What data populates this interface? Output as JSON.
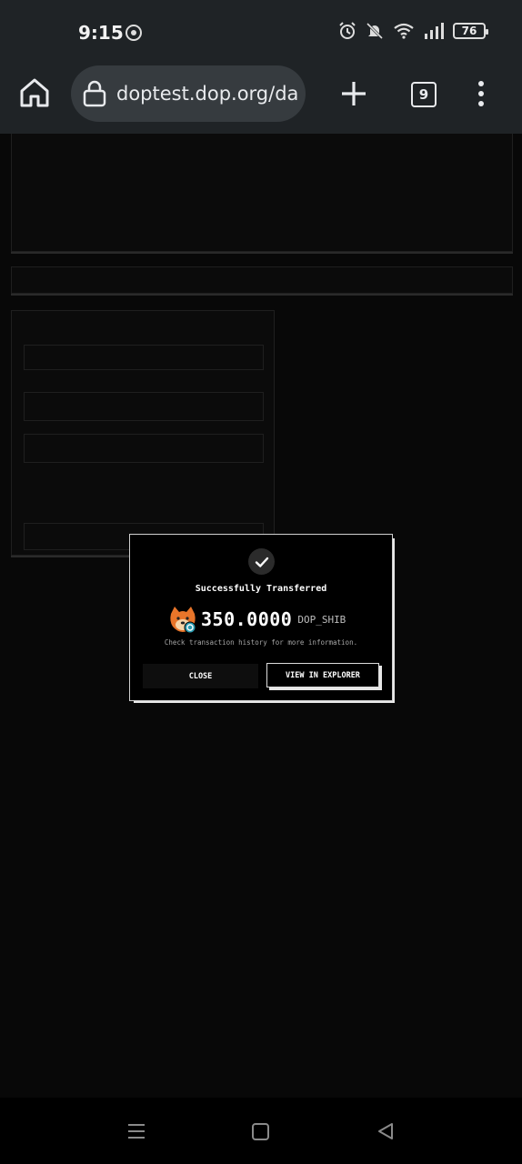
{
  "status_bar": {
    "time": "9:15",
    "battery": "76",
    "icons": [
      "chrome-icon",
      "alarm-icon",
      "mute-icon",
      "wifi-icon",
      "signal-icon",
      "battery-icon"
    ]
  },
  "browser": {
    "url": "doptest.dop.org/da",
    "tab_count": "9",
    "icons": [
      "home-icon",
      "lock-icon",
      "plus-icon",
      "more-vert-icon"
    ]
  },
  "modal": {
    "title": "Successfully Transferred",
    "amount": "350.0000",
    "token_symbol": "DOP_SHIB",
    "subtitle": "Check transaction history for more information.",
    "close_label": "CLOSE",
    "explorer_label": "VIEW IN EXPLORER",
    "icons": [
      "check-icon",
      "token-icon"
    ]
  },
  "nav_bar": {
    "icons": [
      "recents-icon",
      "home-square-icon",
      "back-icon"
    ]
  }
}
